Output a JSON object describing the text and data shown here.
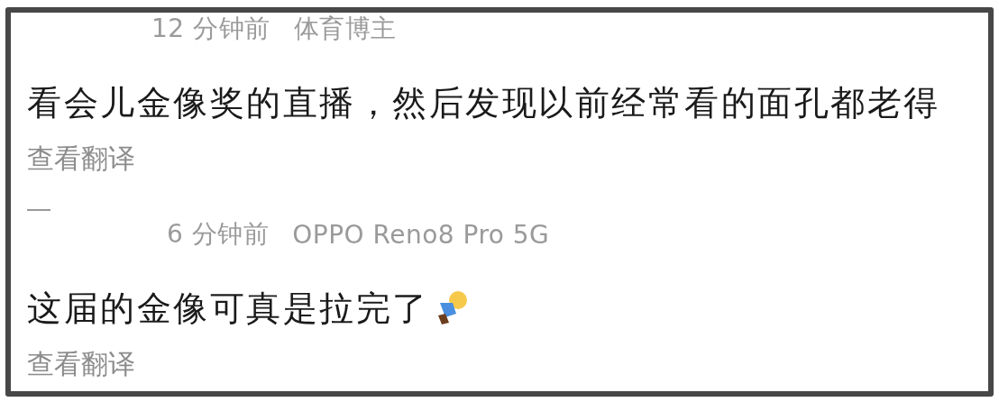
{
  "comments": [
    {
      "time": "12 分钟前",
      "source": "体育博主",
      "text": "看会儿金像奖的直播，然后发现以前经常看的面孔都老得",
      "translate": "查看翻译",
      "divider_after": true,
      "emoji": false
    },
    {
      "time": "6 分钟前",
      "source": "OPPO Reno8 Pro 5G",
      "text": "这届的金像可真是拉完了",
      "translate": "查看翻译",
      "divider_after": false,
      "emoji": true
    }
  ]
}
